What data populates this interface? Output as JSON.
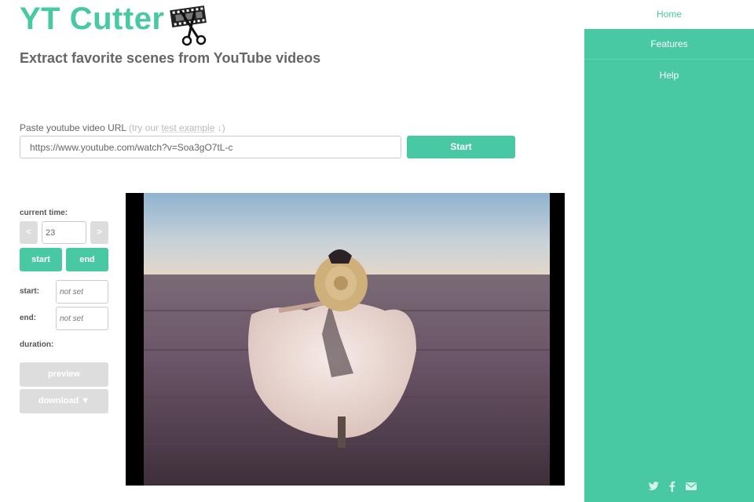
{
  "header": {
    "logo": "YT Cutter",
    "tagline": "Extract favorite scenes from YouTube videos"
  },
  "url_section": {
    "label": "Paste youtube video URL",
    "hint_prefix": "(try our",
    "hint_link": "test example",
    "hint_suffix": "↓)",
    "url_value": "https://www.youtube.com/watch?v=Soa3gO7tL-c",
    "start_label": "Start"
  },
  "controls": {
    "current_time_label": "current time:",
    "prev_label": "<",
    "next_label": ">",
    "current_time_value": "23",
    "start_label": "start",
    "end_label": "end",
    "start_field_label": "start:",
    "end_field_label": "end:",
    "not_set_placeholder": "not set",
    "duration_label": "duration:",
    "preview_label": "preview",
    "download_label": "download ▼"
  },
  "nav": {
    "items": [
      {
        "label": "Home",
        "active": true
      },
      {
        "label": "Features",
        "active": false
      },
      {
        "label": "Help",
        "active": false
      }
    ]
  },
  "social": [
    "twitter-icon",
    "facebook-icon",
    "email-icon"
  ],
  "colors": {
    "accent": "#48c9a4",
    "disabled": "#dddddd"
  }
}
